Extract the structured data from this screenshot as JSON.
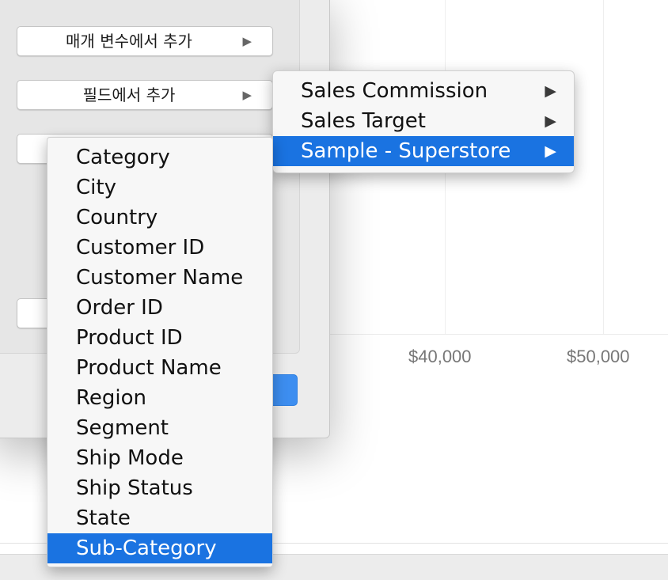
{
  "chart": {
    "ticks": [
      "$40,000",
      "$50,000"
    ]
  },
  "dialog": {
    "add_from_parameter": "매개 변수에서 추가",
    "add_from_field": "필드에서 추가",
    "arrow": "▶"
  },
  "field_sources": [
    {
      "label": "Sales Commission",
      "arrow": "▶",
      "selected": false
    },
    {
      "label": "Sales Target",
      "arrow": "▶",
      "selected": false
    },
    {
      "label": "Sample - Superstore",
      "arrow": "▶",
      "selected": true
    }
  ],
  "fields": [
    "Category",
    "City",
    "Country",
    "Customer ID",
    "Customer Name",
    "Order ID",
    "Product ID",
    "Product Name",
    "Region",
    "Segment",
    "Ship Mode",
    "Ship Status",
    "State",
    "Sub-Category"
  ],
  "selected_field": "Sub-Category",
  "colors": {
    "selection": "#1a73e1",
    "primary_button": "#3d8ef0"
  }
}
